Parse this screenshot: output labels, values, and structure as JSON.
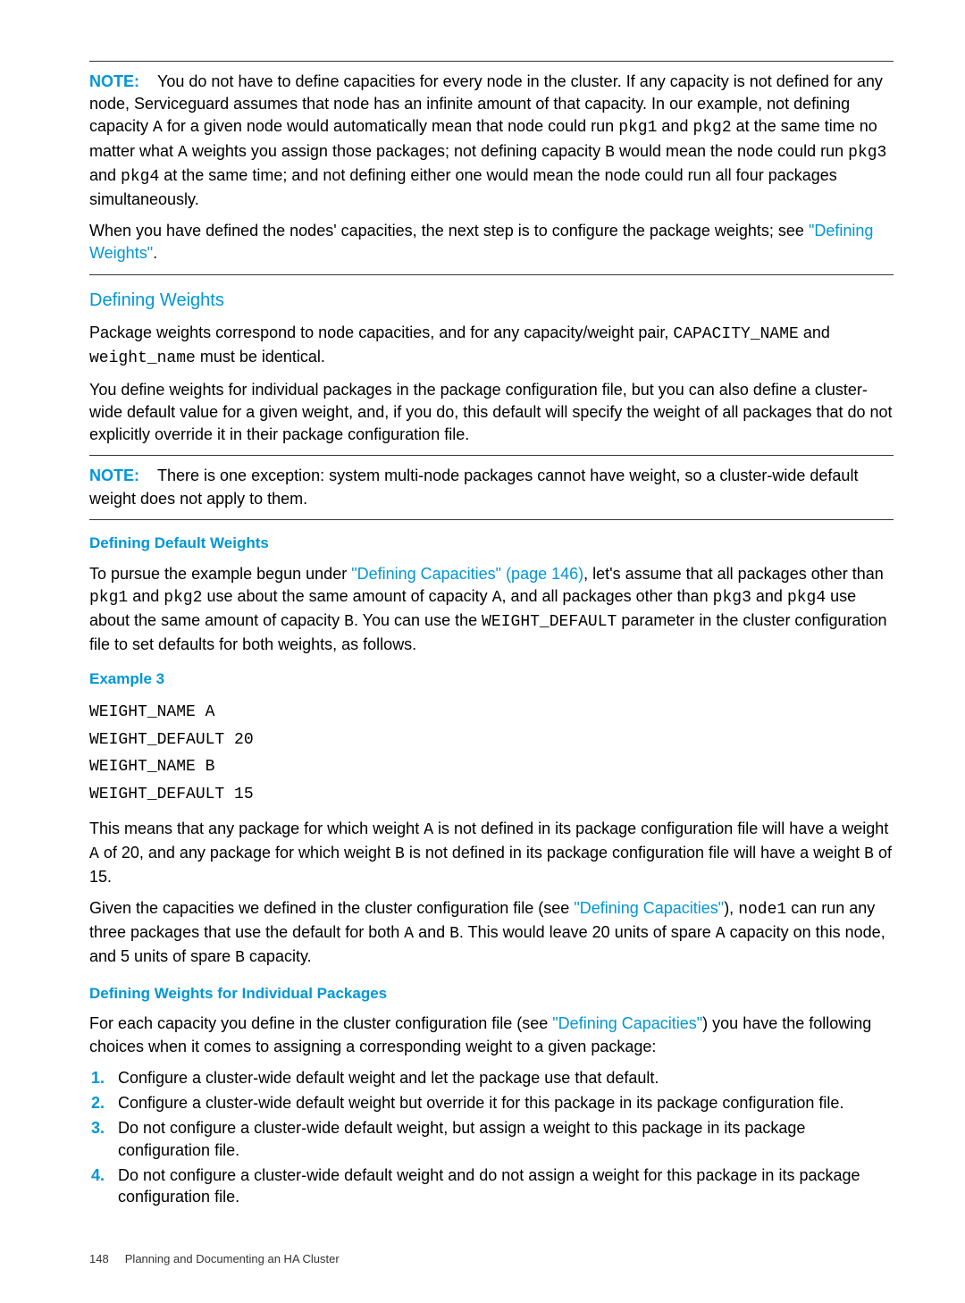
{
  "note1": {
    "label": "NOTE:",
    "p1a": "You do not have to define capacities for every node in the cluster. If any capacity is not defined for any node, Serviceguard assumes that node has an infinite amount of that capacity. In our example, not defining capacity ",
    "A": "A",
    "p1b": " for a given node would automatically mean that node could run ",
    "pkg1": "pkg1",
    "and1": " and ",
    "pkg2": "pkg2",
    "p1c": " at the same time no matter what ",
    "A2": "A",
    "p1d": " weights you assign those packages; not defining capacity ",
    "B": "B",
    "p1e": " would mean the node could run ",
    "pkg3": "pkg3",
    "and2": " and ",
    "pkg4": "pkg4",
    "p1f": " at the same time; and not defining either one would mean the node could run all four packages simultaneously.",
    "p2a": "When you have defined the nodes' capacities, the next step is to configure the package weights; see ",
    "link": "\"Defining Weights\"",
    "p2b": "."
  },
  "section1": {
    "heading": "Defining Weights",
    "p1a": "Package weights correspond to node capacities, and for any capacity/weight pair, ",
    "cap": "CAPACITY_NAME",
    "and": " and ",
    "wt": "weight_name",
    "p1b": " must be identical.",
    "p2": "You define weights for individual packages in the package configuration file, but you can also define a cluster-wide default value for a given weight, and, if you do, this default will specify the weight of all packages that do not explicitly override it in their package configuration file."
  },
  "note2": {
    "label": "NOTE:",
    "text": "There is one exception: system multi-node packages cannot have weight, so a cluster-wide default weight does not apply to them."
  },
  "sub1": {
    "heading": "Defining Default Weights",
    "p1a": "To pursue the example begun under ",
    "link1": "\"Defining Capacities\" (page 146)",
    "p1b": ", let's assume that all packages other than ",
    "pkg1": "pkg1",
    "and1": " and ",
    "pkg2": "pkg2",
    "p1c": " use about the same amount of capacity ",
    "A": "A",
    "p1d": ", and all packages other than ",
    "pkg3": "pkg3",
    "and2": " and ",
    "pkg4": "pkg4",
    "p1e": " use about the same amount of capacity ",
    "B": "B",
    "p1f": ". You can use the ",
    "wd": "WEIGHT_DEFAULT",
    "p1g": " parameter in the cluster configuration file to set defaults for both weights, as follows."
  },
  "example": {
    "label": "Example 3",
    "l1": "WEIGHT_NAME A",
    "l2": "WEIGHT_DEFAULT 20",
    "l3": "WEIGHT_NAME B",
    "l4": "WEIGHT_DEFAULT 15"
  },
  "after_example": {
    "p1a": "This means that any package for which weight ",
    "A1": "A",
    "p1b": " is not defined in its package configuration file will have a weight ",
    "A2": "A",
    "p1c": " of 20, and any package for which weight ",
    "B1": "B",
    "p1d": " is not defined in its package configuration file will have a weight ",
    "B2": "B",
    "p1e": " of 15.",
    "p2a": "Given the capacities we defined in the cluster configuration file (see ",
    "link": "\"Defining Capacities\"",
    "p2b": "), ",
    "node1": "node1",
    "p2c": " can run any three packages that use the default for both ",
    "A3": "A",
    "and": " and ",
    "B3": "B",
    "p2d": ". This would leave 20 units of spare ",
    "A4": "A",
    "p2e": " capacity on this node, and 5 units of spare ",
    "B4": "B",
    "p2f": " capacity."
  },
  "sub2": {
    "heading": "Defining Weights for Individual Packages",
    "p1a": "For each capacity you define in the cluster configuration file (see ",
    "link": "\"Defining Capacities\"",
    "p1b": ") you have the following choices when it comes to assigning a corresponding weight to a given package:",
    "items": [
      {
        "num": "1.",
        "text": "Configure a cluster-wide default weight and let the package use that default."
      },
      {
        "num": "2.",
        "text": "Configure a cluster-wide default weight but override it for this package in its package configuration file."
      },
      {
        "num": "3.",
        "text": "Do not configure a cluster-wide default weight, but assign a weight to this package in its package configuration file."
      },
      {
        "num": "4.",
        "text": "Do not configure a cluster-wide default weight and do not assign a weight for this package in its package configuration file."
      }
    ]
  },
  "footer": {
    "page": "148",
    "chapter": "Planning and Documenting an HA Cluster"
  }
}
